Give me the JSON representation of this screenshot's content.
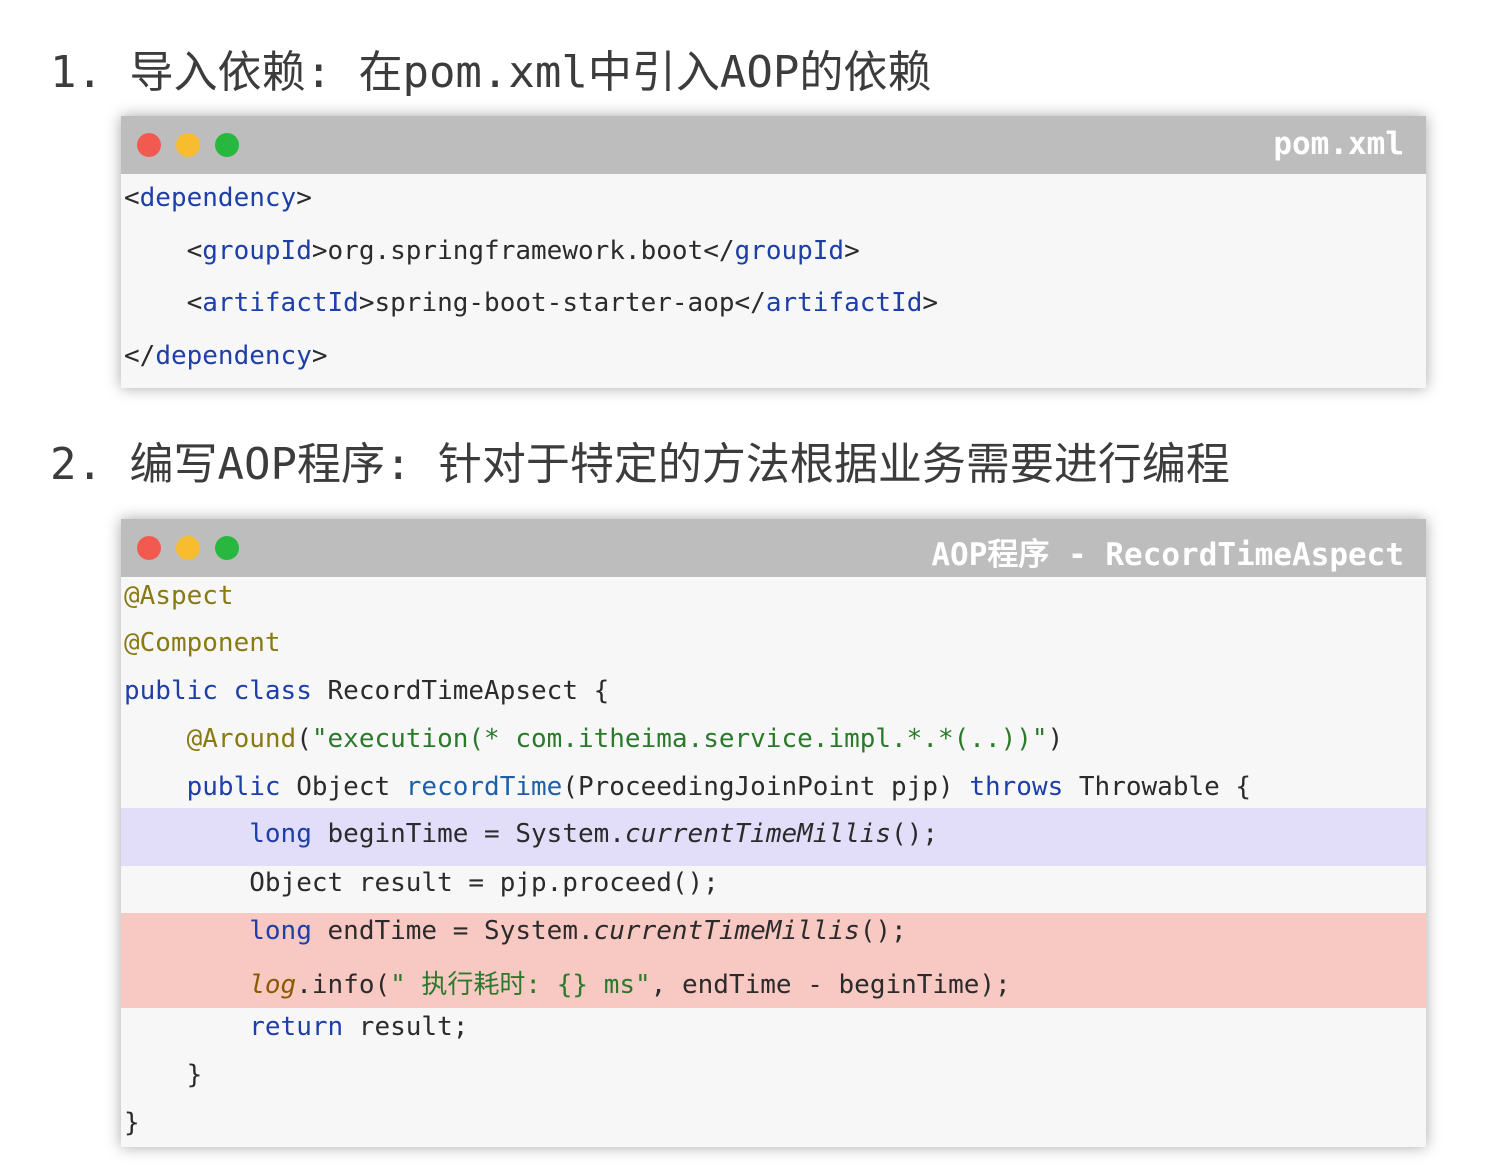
{
  "step1": {
    "heading": "1. 导入依赖: 在pom.xml中引入AOP的依赖",
    "window_title": "pom.xml",
    "code": {
      "l1_open": "<",
      "l1_tag": "dependency",
      "l1_close": ">",
      "l2_indent": "    ",
      "l2_tag_open": "groupId",
      "l2_value": "org.springframework.boot",
      "l2_tag_close": "groupId",
      "l3_tag_open": "artifactId",
      "l3_value": "spring-boot-starter-aop",
      "l3_tag_close": "artifactId",
      "l4_tag": "dependency"
    }
  },
  "step2": {
    "heading": "2. 编写AOP程序: 针对于特定的方法根据业务需要进行编程",
    "window_title": "AOP程序 - RecordTimeAspect",
    "code": {
      "a1": "@Aspect",
      "a2": "@Component",
      "l3_kw1": "public",
      "l3_kw2": "class",
      "l3_rest": " RecordTimeApsect {",
      "l4_ann": "@Around",
      "l4_p1": "(",
      "l4_str": "\"execution(* com.itheima.service.impl.*.*(..))\"",
      "l4_p2": ")",
      "l5_kw": "public",
      "l5_type": " Object ",
      "l5_fn": "recordTime",
      "l5_params": "(ProceedingJoinPoint pjp) ",
      "l5_kw2": "throws",
      "l5_rest": " Throwable {",
      "l6_kw": "long",
      "l6_mid": " beginTime = System.",
      "l6_ital": "currentTimeMillis",
      "l6_end": "();",
      "l7": "Object result = pjp.proceed();",
      "l8_kw": "long",
      "l8_mid": " endTime = System.",
      "l8_ital": "currentTimeMillis",
      "l8_end": "();",
      "l9_log": "log",
      "l9_a": ".info(",
      "l9_str": "\" 执行耗时: {} ms\"",
      "l9_b": ", endTime - beginTime);",
      "l10_kw": "return",
      "l10_rest": " result;",
      "l11": "}",
      "l12": "}"
    }
  }
}
